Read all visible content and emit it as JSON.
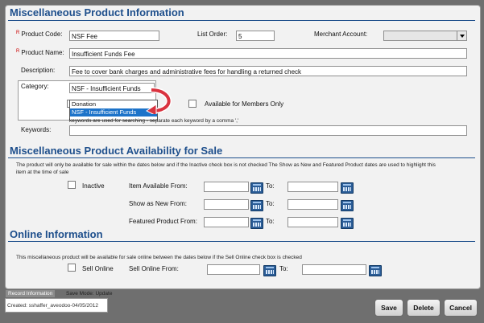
{
  "sections": {
    "product_info": "Miscellaneous Product Information",
    "availability": "Miscellaneous Product Availability for Sale",
    "online": "Online Information"
  },
  "required_marker": "R",
  "fields": {
    "product_code": {
      "label": "Product Code:",
      "value": "NSF Fee"
    },
    "list_order": {
      "label": "List Order:",
      "value": "5"
    },
    "merchant_account": {
      "label": "Merchant Account:",
      "value": ""
    },
    "product_name": {
      "label": "Product Name:",
      "value": "Insufficient Funds Fee"
    },
    "description": {
      "label": "Description:",
      "value": "Fee to cover bank charges and administrative fees for handling a returned check"
    },
    "category": {
      "label": "Category:",
      "value": "NSF - Insufficient Funds",
      "options": [
        "Donation",
        "NSF - Insufficient Funds"
      ]
    },
    "members_only": {
      "label": "Available for Members Only"
    },
    "keywords": {
      "label": "Keywords:",
      "hint": "keywords are used for searching - separate each keyword by a comma ','",
      "value": ""
    }
  },
  "availability": {
    "note": "The product will only be available for sale within the dates below and if the Inactive check box is not checked The Show as New and Featured Product dates are used to highlight this item at the time of sale",
    "inactive_label": "Inactive",
    "item_available_label": "Item Available From:",
    "show_new_label": "Show as New From:",
    "featured_label": "Featured Product From:",
    "to_label": "To:"
  },
  "online": {
    "note": "This miscellaneous product will be available for sale online between the dates below if the Sell Online check box is checked",
    "sell_online_label": "Sell Online",
    "sell_online_from_label": "Sell Online From:",
    "to_label": "To:"
  },
  "footer": {
    "record_info_tab": "Record Information",
    "save_mode": "Save Mode: Update",
    "created": "Created: sshaffer_aveodoo-04/05/2012",
    "save": "Save",
    "delete": "Delete",
    "cancel": "Cancel"
  },
  "colors": {
    "heading": "#1e4f8c",
    "selected": "#1d73c9",
    "arrow": "#d9333f"
  }
}
